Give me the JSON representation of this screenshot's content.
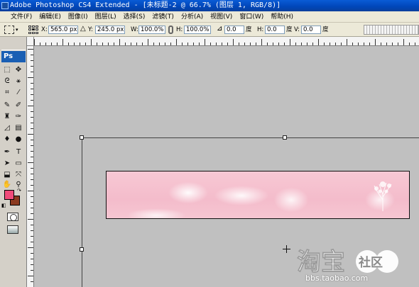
{
  "window": {
    "title": "Adobe Photoshop CS4 Extended - [未标题-2 @ 66.7% (图层 1, RGB/8)]"
  },
  "menu": [
    "文件(F)",
    "编辑(E)",
    "图像(I)",
    "图层(L)",
    "选择(S)",
    "滤镜(T)",
    "分析(A)",
    "视图(V)",
    "窗口(W)",
    "帮助(H)"
  ],
  "options": {
    "x_label": "X:",
    "x_value": "565.0 px",
    "y_label": "Y:",
    "y_value": "245.0 px",
    "w_label": "W:",
    "w_value": "100.0%",
    "h_label": "H:",
    "h_value": "100.0%",
    "angle_value": "0.0",
    "angle_unit": "度",
    "hskew_label": "H:",
    "hskew_value": "0.0",
    "hskew_unit": "度",
    "vskew_label": "V:",
    "vskew_value": "0.0",
    "vskew_unit": "度"
  },
  "toolbox": {
    "logo": "Ps",
    "foreground_color": "#ef4b7a",
    "background_color": "#8b3a20"
  },
  "watermark": {
    "logo_text": "淘宝",
    "badge_text": "社区",
    "url": "bbs.taobao.com"
  },
  "colors": {
    "titlebar": "#0046b8",
    "workspace": "#c0c0c0",
    "banner_pink": "#f4bccb"
  }
}
